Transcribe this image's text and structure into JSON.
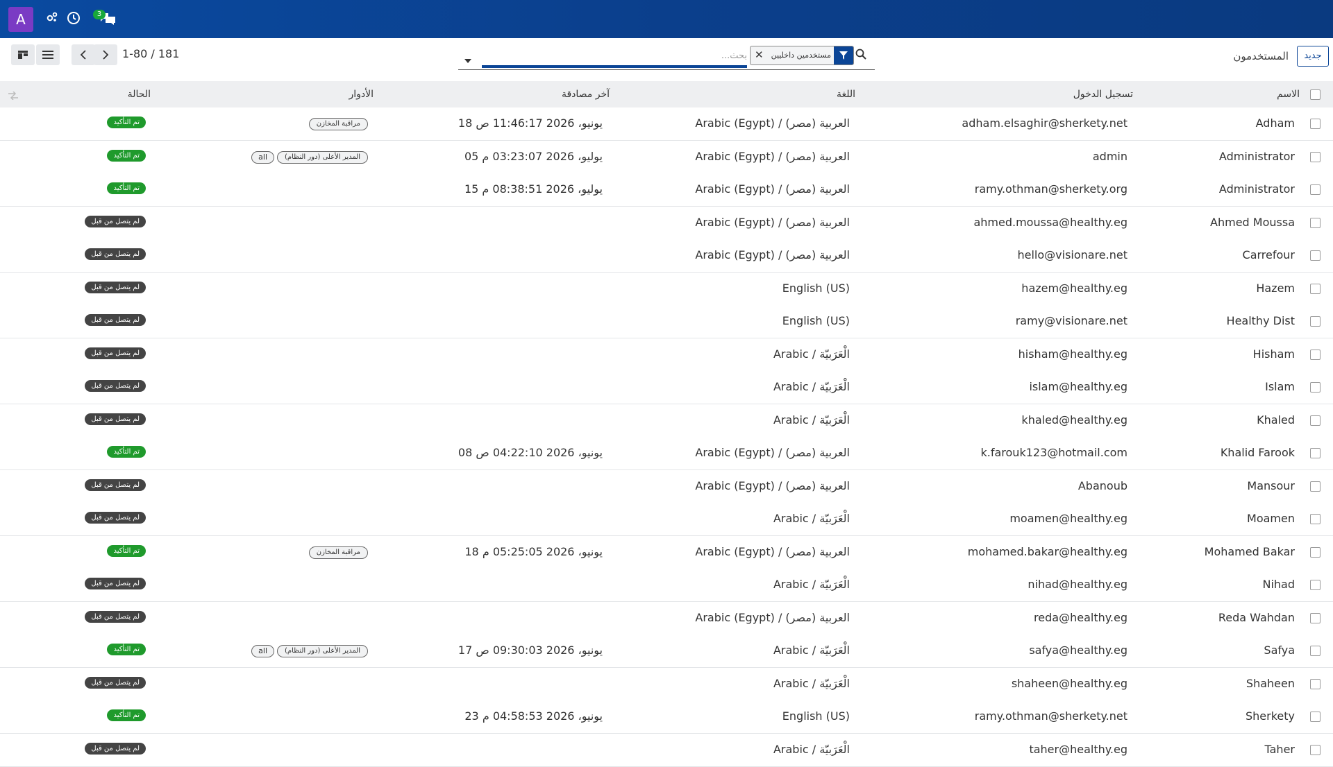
{
  "navbar": {
    "avatar_letter": "A",
    "icons": [
      "settings-icon",
      "clock-icon",
      "chat-icon"
    ],
    "chat_badge": "3",
    "bg_color": "#0b3f8c"
  },
  "panel": {
    "breadcrumb": "المستخدمون",
    "new_button": "جديد",
    "pager": "1-80 / 181",
    "search": {
      "placeholder": "بحث...",
      "facet_label": "مستخدمين داخليين"
    }
  },
  "table": {
    "headers": {
      "name": "الاسم",
      "login": "تسجيل الدخول",
      "language": "اللغة",
      "last_auth": "آخر مصادقة",
      "roles": "الأدوار",
      "status": "الحالة"
    },
    "rows": [
      {
        "name": "Adham",
        "login": "adham.elsaghir@sherkety.net",
        "language": "Arabic (Egypt) / العربية (مصر)",
        "last_auth": "18 يونيو، 2026 11:46:17 ص",
        "roles": [
          "مراقبة المخازن"
        ],
        "status": "تم التأكيد",
        "status_type": "confirmed"
      },
      {
        "name": "Administrator",
        "login": "admin",
        "language": "Arabic (Egypt) / العربية (مصر)",
        "last_auth": "05 يوليو، 2026 03:23:07 م",
        "roles": [
          "المدير الأعلى (دور النظام)",
          "all"
        ],
        "status": "تم التأكيد",
        "status_type": "confirmed"
      },
      {
        "name": "Administrator",
        "login": "ramy.othman@sherkety.org",
        "language": "Arabic (Egypt) / العربية (مصر)",
        "last_auth": "15 يوليو، 2026 08:38:51 م",
        "roles": [],
        "status": "تم التأكيد",
        "status_type": "confirmed"
      },
      {
        "name": "Ahmed Moussa",
        "login": "ahmed.moussa@healthy.eg",
        "language": "Arabic (Egypt) / العربية (مصر)",
        "last_auth": "",
        "roles": [],
        "status": "لم يتصل من قبل",
        "status_type": "never"
      },
      {
        "name": "Carrefour",
        "login": "hello@visionare.net",
        "language": "Arabic (Egypt) / العربية (مصر)",
        "last_auth": "",
        "roles": [],
        "status": "لم يتصل من قبل",
        "status_type": "never"
      },
      {
        "name": "Hazem",
        "login": "hazem@healthy.eg",
        "language": "English (US)",
        "last_auth": "",
        "roles": [],
        "status": "لم يتصل من قبل",
        "status_type": "never"
      },
      {
        "name": "Healthy Dist",
        "login": "ramy@visionare.net",
        "language": "English (US)",
        "last_auth": "",
        "roles": [],
        "status": "لم يتصل من قبل",
        "status_type": "never"
      },
      {
        "name": "Hisham",
        "login": "hisham@healthy.eg",
        "language": "Arabic / الْعَرَبيّة",
        "last_auth": "",
        "roles": [],
        "status": "لم يتصل من قبل",
        "status_type": "never"
      },
      {
        "name": "Islam",
        "login": "islam@healthy.eg",
        "language": "Arabic / الْعَرَبيّة",
        "last_auth": "",
        "roles": [],
        "status": "لم يتصل من قبل",
        "status_type": "never"
      },
      {
        "name": "Khaled",
        "login": "khaled@healthy.eg",
        "language": "Arabic / الْعَرَبيّة",
        "last_auth": "",
        "roles": [],
        "status": "لم يتصل من قبل",
        "status_type": "never"
      },
      {
        "name": "Khalid Farook",
        "login": "k.farouk123@hotmail.com",
        "language": "Arabic (Egypt) / العربية (مصر)",
        "last_auth": "08 يونيو، 2026 04:22:10 ص",
        "roles": [],
        "status": "تم التأكيد",
        "status_type": "confirmed"
      },
      {
        "name": "Mansour",
        "login": "Abanoub",
        "language": "Arabic (Egypt) / العربية (مصر)",
        "last_auth": "",
        "roles": [],
        "status": "لم يتصل من قبل",
        "status_type": "never"
      },
      {
        "name": "Moamen",
        "login": "moamen@healthy.eg",
        "language": "Arabic / الْعَرَبيّة",
        "last_auth": "",
        "roles": [],
        "status": "لم يتصل من قبل",
        "status_type": "never"
      },
      {
        "name": "Mohamed Bakar",
        "login": "mohamed.bakar@healthy.eg",
        "language": "Arabic (Egypt) / العربية (مصر)",
        "last_auth": "18 يونيو، 2026 05:25:05 م",
        "roles": [
          "مراقبة المخازن"
        ],
        "status": "تم التأكيد",
        "status_type": "confirmed"
      },
      {
        "name": "Nihad",
        "login": "nihad@healthy.eg",
        "language": "Arabic / الْعَرَبيّة",
        "last_auth": "",
        "roles": [],
        "status": "لم يتصل من قبل",
        "status_type": "never"
      },
      {
        "name": "Reda Wahdan",
        "login": "reda@healthy.eg",
        "language": "Arabic (Egypt) / العربية (مصر)",
        "last_auth": "",
        "roles": [],
        "status": "لم يتصل من قبل",
        "status_type": "never"
      },
      {
        "name": "Safya",
        "login": "safya@healthy.eg",
        "language": "Arabic / الْعَرَبيّة",
        "last_auth": "17 يونيو، 2026 09:30:03 ص",
        "roles": [
          "المدير الأعلى (دور النظام)",
          "all"
        ],
        "status": "تم التأكيد",
        "status_type": "confirmed"
      },
      {
        "name": "Shaheen",
        "login": "shaheen@healthy.eg",
        "language": "Arabic / الْعَرَبيّة",
        "last_auth": "",
        "roles": [],
        "status": "لم يتصل من قبل",
        "status_type": "never"
      },
      {
        "name": "Sherkety",
        "login": "ramy.othman@sherkety.net",
        "language": "English (US)",
        "last_auth": "23 يونيو، 2026 04:58:53 م",
        "roles": [],
        "status": "تم التأكيد",
        "status_type": "confirmed"
      },
      {
        "name": "Taher",
        "login": "taher@healthy.eg",
        "language": "Arabic / الْعَرَبيّة",
        "last_auth": "",
        "roles": [],
        "status": "لم يتصل من قبل",
        "status_type": "never"
      }
    ]
  },
  "colors": {
    "confirmed": "#1f9a2c",
    "never": "#444444",
    "accent": "#0b4596"
  }
}
